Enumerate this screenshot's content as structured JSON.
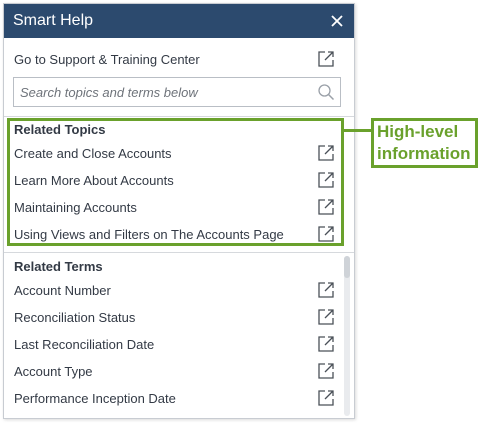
{
  "window": {
    "title": "Smart Help",
    "close_icon": "close-icon"
  },
  "support_link": {
    "label": "Go to Support & Training Center",
    "icon": "external-link-icon"
  },
  "search": {
    "placeholder": "Search topics and terms below",
    "icon": "search-icon"
  },
  "related_topics": {
    "heading": "Related Topics",
    "items": [
      "Create and Close Accounts",
      "Learn More About Accounts",
      "Maintaining Accounts",
      "Using Views and Filters on The Accounts Page"
    ]
  },
  "related_terms": {
    "heading": "Related Terms",
    "items": [
      "Account Number",
      "Reconciliation Status",
      "Last Reconciliation Date",
      "Account Type",
      "Performance Inception Date"
    ]
  },
  "annotation": {
    "line1": "High-level",
    "line2": "information",
    "color": "#6aa12c"
  },
  "colors": {
    "titlebar": "#2c4a6e",
    "text": "#333a45"
  }
}
